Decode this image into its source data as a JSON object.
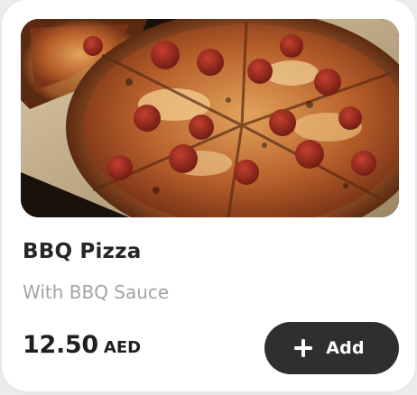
{
  "product": {
    "image_alt": "Pepperoni pizza",
    "name": "BBQ Pizza",
    "description": "With BBQ Sauce",
    "price": "12.50",
    "currency": "AED"
  },
  "actions": {
    "add_label": "Add",
    "add_icon": "plus-icon"
  },
  "colors": {
    "card_bg": "#ffffff",
    "title": "#262626",
    "subtitle": "#a3a3a3",
    "button_bg": "#2f2f2f",
    "button_text": "#ffffff"
  }
}
